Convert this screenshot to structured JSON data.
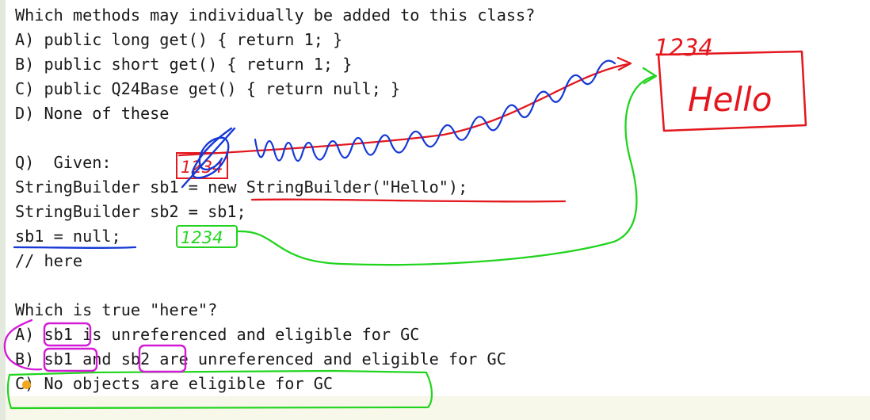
{
  "document": {
    "lines": [
      "Which methods may individually be added to this class?",
      "A) public long get() { return 1; }",
      "B) public short get() { return 1; }",
      "C) public Q24Base get() { return null; }",
      "D) None of these",
      "",
      "Q)  Given:",
      "StringBuilder sb1 = new StringBuilder(\"Hello\");",
      "StringBuilder sb2 = sb1;",
      "sb1 = null;",
      "// here",
      "",
      "Which is true \"here\"?",
      "A) sb1 is unreferenced and eligible for GC",
      "B) sb1 and sb2 are unreferenced and eligible for GC",
      "C) No objects are eligible for GC"
    ]
  },
  "annotations": {
    "heap_object_label": "Hello",
    "heap_address": "1234",
    "sb1_old_value": "1234",
    "sb2_value": "1234",
    "colors": {
      "red": "#e3171d",
      "green": "#22d41f",
      "blue": "#1538d6",
      "magenta": "#d21ad6",
      "text": "#1a1a1a"
    }
  }
}
